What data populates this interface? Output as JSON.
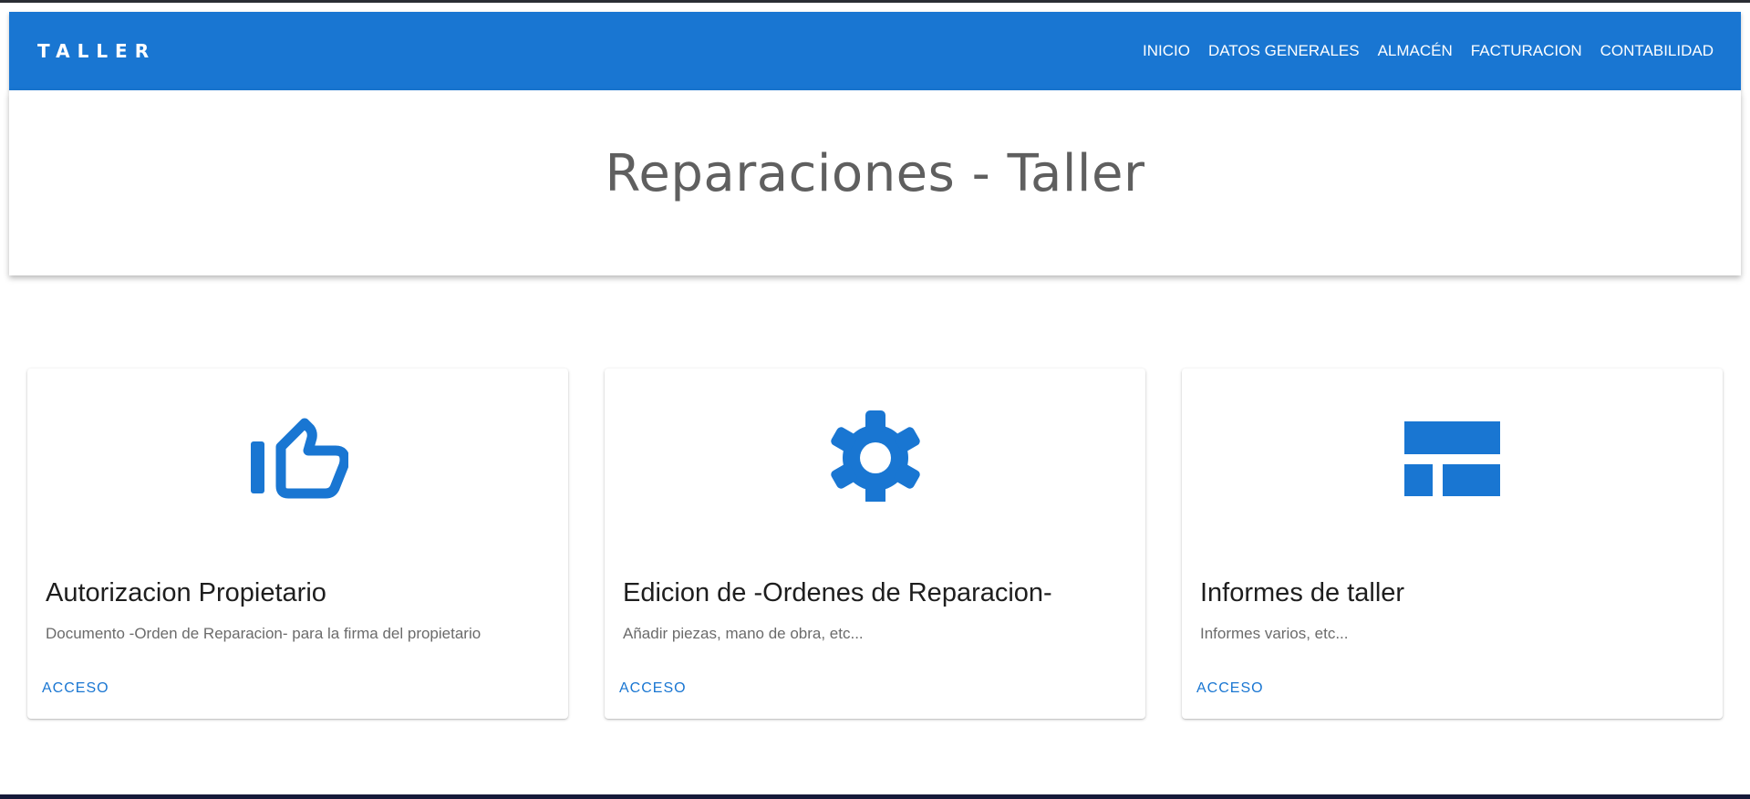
{
  "navbar": {
    "brand": "TALLER",
    "links": [
      {
        "label": "INICIO"
      },
      {
        "label": "DATOS GENERALES"
      },
      {
        "label": "ALMACÉN"
      },
      {
        "label": "FACTURACION"
      },
      {
        "label": "CONTABILIDAD"
      }
    ]
  },
  "hero": {
    "title": "Reparaciones - Taller"
  },
  "cards": [
    {
      "icon": "thumb-up-icon",
      "title": "Autorizacion Propietario",
      "description": "Documento -Orden de Reparacion- para la firma del propietario",
      "action": "ACCESO"
    },
    {
      "icon": "gear-icon",
      "title": "Edicion de -Ordenes de Reparacion-",
      "description": "Añadir piezas, mano de obra, etc...",
      "action": "ACCESO"
    },
    {
      "icon": "web-layout-icon",
      "title": "Informes de taller",
      "description": "Informes varios, etc...",
      "action": "ACCESO"
    }
  ],
  "colors": {
    "primary": "#1976d2",
    "hero_text": "#5f5f5f",
    "card_title": "#1e1e1e",
    "card_desc": "#6b6b6b"
  }
}
